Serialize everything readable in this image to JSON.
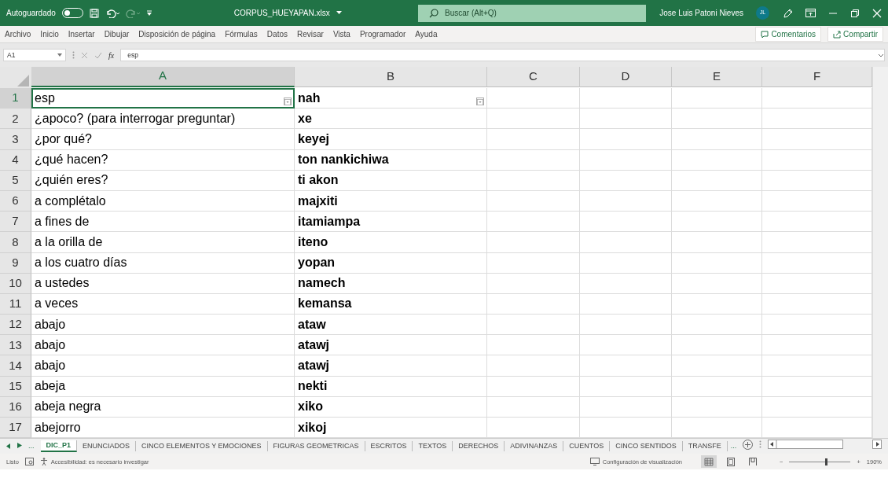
{
  "title_bar": {
    "autosave_label": "Autoguardado",
    "autosave_on": false,
    "filename": "CORPUS_HUEYAPAN.xlsx",
    "search_placeholder": "Buscar (Alt+Q)",
    "user_name": "Jose Luis Patoni Nieves",
    "avatar_initials": "JL"
  },
  "menu": {
    "items": [
      "Archivo",
      "Inicio",
      "Insertar",
      "Dibujar",
      "Disposición de página",
      "Fórmulas",
      "Datos",
      "Revisar",
      "Vista",
      "Programador",
      "Ayuda"
    ],
    "comments_button": "Comentarios",
    "share_button": "Compartir"
  },
  "formula_bar": {
    "name_box": "A1",
    "function_symbol": "fx",
    "value": "esp"
  },
  "sheet": {
    "columns": [
      {
        "label": "A",
        "selected": true
      },
      {
        "label": "B",
        "selected": false
      },
      {
        "label": "C",
        "selected": false
      },
      {
        "label": "D",
        "selected": false
      },
      {
        "label": "E",
        "selected": false
      },
      {
        "label": "F",
        "selected": false
      }
    ],
    "rows": [
      {
        "number": "1",
        "selected": true,
        "cells": [
          "esp",
          "nah"
        ]
      },
      {
        "number": "2",
        "selected": false,
        "cells": [
          "¿apoco? (para interrogar preguntar)",
          "xe"
        ]
      },
      {
        "number": "3",
        "selected": false,
        "cells": [
          "¿por qué?",
          "keyej"
        ]
      },
      {
        "number": "4",
        "selected": false,
        "cells": [
          "¿qué hacen?",
          "ton nankichiwa"
        ]
      },
      {
        "number": "5",
        "selected": false,
        "cells": [
          "¿quién eres?",
          "ti akon"
        ]
      },
      {
        "number": "6",
        "selected": false,
        "cells": [
          "a complétalo",
          "majxiti"
        ]
      },
      {
        "number": "7",
        "selected": false,
        "cells": [
          "a fines de",
          "itamiampa"
        ]
      },
      {
        "number": "8",
        "selected": false,
        "cells": [
          "a la orilla de",
          "iteno"
        ]
      },
      {
        "number": "9",
        "selected": false,
        "cells": [
          "a los cuatro días",
          "yopan"
        ]
      },
      {
        "number": "10",
        "selected": false,
        "cells": [
          "a ustedes",
          "namech"
        ]
      },
      {
        "number": "11",
        "selected": false,
        "cells": [
          "a veces",
          "kemansa"
        ]
      },
      {
        "number": "12",
        "selected": false,
        "cells": [
          "abajo",
          "ataw"
        ]
      },
      {
        "number": "13",
        "selected": false,
        "cells": [
          "abajo",
          "atawj"
        ]
      },
      {
        "number": "14",
        "selected": false,
        "cells": [
          "abajo",
          "atawj"
        ]
      },
      {
        "number": "15",
        "selected": false,
        "cells": [
          "abeja",
          "nekti"
        ]
      },
      {
        "number": "16",
        "selected": false,
        "cells": [
          "abeja negra",
          "xiko"
        ]
      },
      {
        "number": "17",
        "selected": false,
        "cells": [
          "abejorro",
          "xikoj"
        ]
      }
    ]
  },
  "sheet_tabs": {
    "more": "...",
    "tabs": [
      {
        "label": "DIC_P1",
        "selected": true
      },
      {
        "label": "ENUNCIADOS",
        "selected": false
      },
      {
        "label": "CINCO ELEMENTOS Y EMOCIONES",
        "selected": false
      },
      {
        "label": "FIGURAS GEOMETRICAS",
        "selected": false
      },
      {
        "label": "ESCRITOS",
        "selected": false
      },
      {
        "label": "TEXTOS",
        "selected": false
      },
      {
        "label": "DERECHOS",
        "selected": false
      },
      {
        "label": "ADIVINANZAS",
        "selected": false
      },
      {
        "label": "CUENTOS",
        "selected": false
      },
      {
        "label": "CINCO SENTIDOS",
        "selected": false
      },
      {
        "label": "TRANSFE",
        "selected": false
      }
    ],
    "overflow": "..."
  },
  "status_bar": {
    "status": "Listo",
    "accessibility": "Accesibilidad: es necesario investigar",
    "display_settings": "Configuración de visualización",
    "views": [
      {
        "kind": "normal",
        "selected": true
      },
      {
        "kind": "layout",
        "selected": false
      },
      {
        "kind": "pagebreak",
        "selected": false
      }
    ],
    "zoom": {
      "zoom_out": "−",
      "level": 0.6,
      "zoom_in": "+",
      "reading": "190%"
    }
  }
}
